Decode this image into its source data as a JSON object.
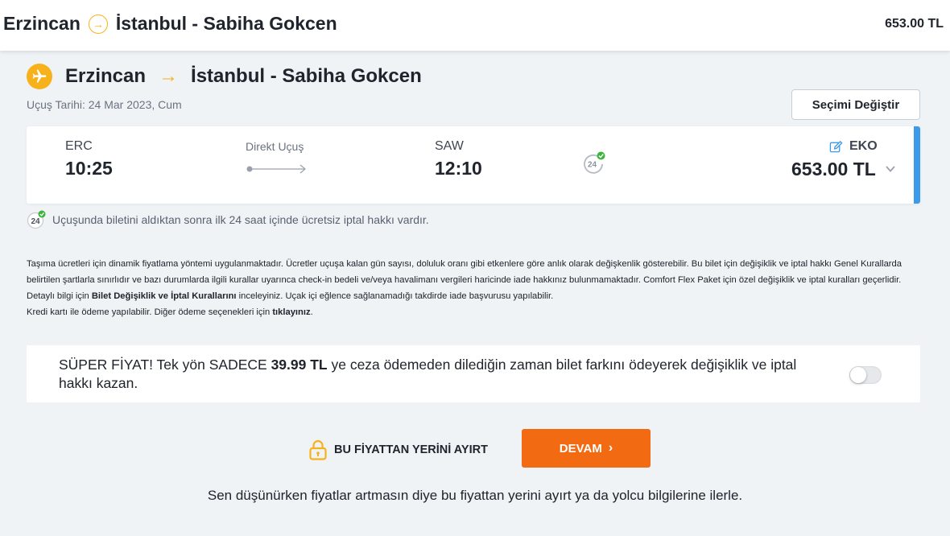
{
  "topbar": {
    "origin": "Erzincan",
    "destination": "İstanbul - Sabiha Gokcen",
    "price": "653.00 TL"
  },
  "flight_header": {
    "origin": "Erzincan",
    "destination": "İstanbul - Sabiha Gokcen",
    "date": "Uçuş Tarihi: 24 Mar 2023, Cum",
    "change_button": "Seçimi Değiştir"
  },
  "flight": {
    "dep_code": "ERC",
    "dep_time": "10:25",
    "type": "Direkt Uçuş",
    "arr_code": "SAW",
    "arr_time": "12:10",
    "fare_class": "EKO",
    "price": "653.00 TL"
  },
  "cancel_note": "Uçuşunda biletini aldıktan sonra ilk 24 saat içinde ücretsiz iptal hakkı vardır.",
  "terms": {
    "p1": "Taşıma ücretleri için dinamik fiyatlama yöntemi uygulanmaktadır. Ücretler uçuşa kalan gün sayısı, doluluk oranı gibi etkenlere göre anlık olarak değişkenlik gösterebilir. Bu bilet için değişiklik ve iptal hakkı Genel Kurallarda belirtilen şartlarla sınırlıdır ve bazı durumlarda ilgili kurallar uyarınca check-in bedeli ve/veya havalimanı vergileri haricinde iade hakkınız bulunmamaktadır. Comfort Flex Paket için özel değişiklik ve iptal kuralları geçerlidir. Detaylı bilgi için ",
    "rules_link": "Bilet Değişiklik ve İptal Kurallarını",
    "p2": " inceleyiniz. Uçak içi eğlence sağlanamadığı takdirde iade başvurusu yapılabilir.",
    "p3": "Kredi kartı ile ödeme yapılabilir. Diğer ödeme seçenekleri için ",
    "click_link": "tıklayınız",
    "p3_end": "."
  },
  "promo": {
    "pre": "SÜPER FİYAT! Tek yön SADECE ",
    "price": "39.99 TL",
    "post": " ye ceza ödemeden dilediğin zaman bilet farkını ödeyerek değişiklik ve iptal hakkı kazan.",
    "toggle_on": false
  },
  "actions": {
    "reserve_label": "BU FİYATTAN YERİNİ AYIRT",
    "continue_label": "DEVAM",
    "continue_chevron": "›"
  },
  "footnote": "Sen düşünürken fiyatlar artmasın diye bu fiyattan yerini ayırt ya da yolcu bilgilerine ilerle.",
  "colors": {
    "accent": "#f7b21b",
    "primary_button": "#f26a12",
    "card_accent": "#3b9bea",
    "check": "#3cb43c"
  },
  "icons": [
    "arrow-right-circle-icon",
    "plane-icon",
    "arrow-right-icon",
    "refresh-24-icon",
    "edit-icon",
    "chevron-down-icon",
    "lock-icon",
    "chevron-right-icon"
  ]
}
